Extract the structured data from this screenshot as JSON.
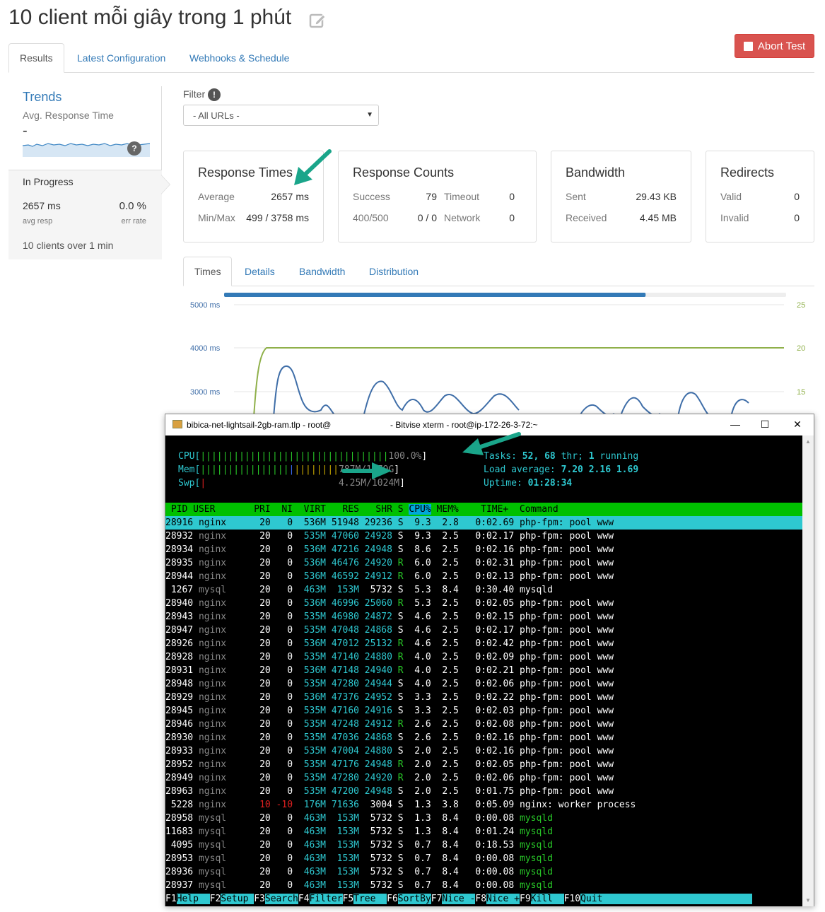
{
  "page": {
    "title": "10 client mỗi giây trong 1 phút",
    "abort_label": "Abort Test"
  },
  "tabs": [
    "Results",
    "Latest Configuration",
    "Webhooks & Schedule"
  ],
  "sidebar": {
    "trends_title": "Trends",
    "trends_sub": "Avg. Response Time",
    "trends_value": "-",
    "help_badge": "?",
    "status": "In Progress",
    "avg_value": "2657 ms",
    "avg_label": "avg resp",
    "err_value": "0.0 %",
    "err_label": "err rate",
    "clients_text": "10 clients over 1 min"
  },
  "filter": {
    "label": "Filter",
    "info": "!",
    "selected": "- All URLs -"
  },
  "cards": {
    "response_times": {
      "title": "Response Times",
      "avg_label": "Average",
      "avg_value": "2657 ms",
      "minmax_label": "Min/Max",
      "minmax_value": "499 / 3758 ms"
    },
    "response_counts": {
      "title": "Response Counts",
      "success_label": "Success",
      "success_value": "79",
      "timeout_label": "Timeout",
      "timeout_value": "0",
      "e400_label": "400/500",
      "e400_value": "0 / 0",
      "network_label": "Network",
      "network_value": "0"
    },
    "bandwidth": {
      "title": "Bandwidth",
      "sent_label": "Sent",
      "sent_value": "29.43 KB",
      "recv_label": "Received",
      "recv_value": "4.45 MB"
    },
    "redirects": {
      "title": "Redirects",
      "valid_label": "Valid",
      "valid_value": "0",
      "invalid_label": "Invalid",
      "invalid_value": "0"
    }
  },
  "subtabs": [
    "Times",
    "Details",
    "Bandwidth",
    "Distribution"
  ],
  "chart_data": {
    "type": "line",
    "left_axis_ticks": [
      "5000 ms",
      "4000 ms",
      "3000 ms"
    ],
    "right_axis_ticks": [
      "25",
      "20",
      "15"
    ],
    "progress": 0.75,
    "series": [
      {
        "values": [
          0,
          20,
          20,
          20,
          20,
          20,
          20,
          20,
          20,
          20,
          20,
          20
        ]
      },
      {
        "values": [
          1600,
          3600,
          3550,
          2700,
          2300,
          2900,
          2400,
          3200,
          2600,
          2200,
          2900,
          2400,
          2600,
          2300,
          2700,
          2900,
          2500,
          2300,
          2800,
          2500
        ]
      }
    ],
    "colors": {
      "clients": "#8fb04a",
      "response": "#3f6ea8",
      "progress": "#337ab7"
    }
  },
  "terminal": {
    "title_left": "bibica-net-lightsail-2gb-ram.tlp - root@",
    "title_right": "- Bitvise xterm - root@ip-172-26-3-72:~",
    "min": "—",
    "max": "☐",
    "close": "✕",
    "cpu_label": "CPU[",
    "cpu_bar": "||||||||||||||||||||||||||||||||||",
    "cpu_value": "100.0%",
    "mem_label": "Mem[",
    "mem_bar_green": "||||||||||||||||",
    "mem_bar_blue": "|",
    "mem_bar_yellow": "||||||||",
    "mem_value": "787M/1.79G",
    "swp_label": "Swp[",
    "swp_bar": "|",
    "swp_value": "4.25M/1024M",
    "tasks_label": "Tasks:",
    "tasks_value": "52,",
    "thr_value": "68",
    "thr_label": "thr;",
    "running_value": "1",
    "running_label": "running",
    "load_label": "Load average:",
    "load_values": "7.20 2.16 1.69",
    "uptime_label": "Uptime:",
    "uptime_value": "01:28:34",
    "header": " PID USER       PRI  NI  VIRT   RES   SHR S ",
    "header_cpu": "CPU%",
    "header_rest": " MEM%    TIME+  Command",
    "rows": [
      {
        "pid": "28916",
        "user": "nginx",
        "pri": "20",
        "ni": "0",
        "virt": "536M",
        "res": "51948",
        "shr": "29236",
        "s": "S",
        "cpu": "9.3",
        "mem": "2.8",
        "time": "0:02.69",
        "cmd": "php-fpm: pool www"
      },
      {
        "pid": "28932",
        "user": "nginx",
        "pri": "20",
        "ni": "0",
        "virt": "535M",
        "res": "47060",
        "shr": "24928",
        "s": "S",
        "cpu": "9.3",
        "mem": "2.5",
        "time": "0:02.17",
        "cmd": "php-fpm: pool www"
      },
      {
        "pid": "28934",
        "user": "nginx",
        "pri": "20",
        "ni": "0",
        "virt": "536M",
        "res": "47216",
        "shr": "24948",
        "s": "S",
        "cpu": "8.6",
        "mem": "2.5",
        "time": "0:02.16",
        "cmd": "php-fpm: pool www"
      },
      {
        "pid": "28935",
        "user": "nginx",
        "pri": "20",
        "ni": "0",
        "virt": "536M",
        "res": "46476",
        "shr": "24920",
        "s": "R",
        "cpu": "6.0",
        "mem": "2.5",
        "time": "0:02.31",
        "cmd": "php-fpm: pool www"
      },
      {
        "pid": "28944",
        "user": "nginx",
        "pri": "20",
        "ni": "0",
        "virt": "536M",
        "res": "46592",
        "shr": "24912",
        "s": "R",
        "cpu": "6.0",
        "mem": "2.5",
        "time": "0:02.13",
        "cmd": "php-fpm: pool www"
      },
      {
        "pid": "1267",
        "user": "mysql",
        "pri": "20",
        "ni": "0",
        "virt": "463M",
        "res": "153M",
        "shr": "5732",
        "s": "S",
        "cpu": "5.3",
        "mem": "8.4",
        "time": "0:30.40",
        "cmd": "mysqld"
      },
      {
        "pid": "28940",
        "user": "nginx",
        "pri": "20",
        "ni": "0",
        "virt": "536M",
        "res": "46996",
        "shr": "25060",
        "s": "R",
        "cpu": "5.3",
        "mem": "2.5",
        "time": "0:02.05",
        "cmd": "php-fpm: pool www"
      },
      {
        "pid": "28943",
        "user": "nginx",
        "pri": "20",
        "ni": "0",
        "virt": "535M",
        "res": "46980",
        "shr": "24872",
        "s": "S",
        "cpu": "4.6",
        "mem": "2.5",
        "time": "0:02.15",
        "cmd": "php-fpm: pool www"
      },
      {
        "pid": "28947",
        "user": "nginx",
        "pri": "20",
        "ni": "0",
        "virt": "535M",
        "res": "47048",
        "shr": "24868",
        "s": "S",
        "cpu": "4.6",
        "mem": "2.5",
        "time": "0:02.17",
        "cmd": "php-fpm: pool www"
      },
      {
        "pid": "28926",
        "user": "nginx",
        "pri": "20",
        "ni": "0",
        "virt": "536M",
        "res": "47012",
        "shr": "25132",
        "s": "R",
        "cpu": "4.6",
        "mem": "2.5",
        "time": "0:02.42",
        "cmd": "php-fpm: pool www"
      },
      {
        "pid": "28928",
        "user": "nginx",
        "pri": "20",
        "ni": "0",
        "virt": "535M",
        "res": "47140",
        "shr": "24880",
        "s": "R",
        "cpu": "4.0",
        "mem": "2.5",
        "time": "0:02.09",
        "cmd": "php-fpm: pool www"
      },
      {
        "pid": "28931",
        "user": "nginx",
        "pri": "20",
        "ni": "0",
        "virt": "536M",
        "res": "47148",
        "shr": "24940",
        "s": "R",
        "cpu": "4.0",
        "mem": "2.5",
        "time": "0:02.21",
        "cmd": "php-fpm: pool www"
      },
      {
        "pid": "28948",
        "user": "nginx",
        "pri": "20",
        "ni": "0",
        "virt": "535M",
        "res": "47280",
        "shr": "24944",
        "s": "S",
        "cpu": "4.0",
        "mem": "2.5",
        "time": "0:02.06",
        "cmd": "php-fpm: pool www"
      },
      {
        "pid": "28929",
        "user": "nginx",
        "pri": "20",
        "ni": "0",
        "virt": "536M",
        "res": "47376",
        "shr": "24952",
        "s": "S",
        "cpu": "3.3",
        "mem": "2.5",
        "time": "0:02.22",
        "cmd": "php-fpm: pool www"
      },
      {
        "pid": "28945",
        "user": "nginx",
        "pri": "20",
        "ni": "0",
        "virt": "535M",
        "res": "47160",
        "shr": "24916",
        "s": "S",
        "cpu": "3.3",
        "mem": "2.5",
        "time": "0:02.03",
        "cmd": "php-fpm: pool www"
      },
      {
        "pid": "28946",
        "user": "nginx",
        "pri": "20",
        "ni": "0",
        "virt": "535M",
        "res": "47248",
        "shr": "24912",
        "s": "R",
        "cpu": "2.6",
        "mem": "2.5",
        "time": "0:02.08",
        "cmd": "php-fpm: pool www"
      },
      {
        "pid": "28930",
        "user": "nginx",
        "pri": "20",
        "ni": "0",
        "virt": "535M",
        "res": "47036",
        "shr": "24868",
        "s": "S",
        "cpu": "2.6",
        "mem": "2.5",
        "time": "0:02.16",
        "cmd": "php-fpm: pool www"
      },
      {
        "pid": "28933",
        "user": "nginx",
        "pri": "20",
        "ni": "0",
        "virt": "535M",
        "res": "47004",
        "shr": "24880",
        "s": "S",
        "cpu": "2.0",
        "mem": "2.5",
        "time": "0:02.16",
        "cmd": "php-fpm: pool www"
      },
      {
        "pid": "28952",
        "user": "nginx",
        "pri": "20",
        "ni": "0",
        "virt": "535M",
        "res": "47176",
        "shr": "24948",
        "s": "R",
        "cpu": "2.0",
        "mem": "2.5",
        "time": "0:02.05",
        "cmd": "php-fpm: pool www"
      },
      {
        "pid": "28949",
        "user": "nginx",
        "pri": "20",
        "ni": "0",
        "virt": "535M",
        "res": "47280",
        "shr": "24920",
        "s": "R",
        "cpu": "2.0",
        "mem": "2.5",
        "time": "0:02.06",
        "cmd": "php-fpm: pool www"
      },
      {
        "pid": "28963",
        "user": "nginx",
        "pri": "20",
        "ni": "0",
        "virt": "535M",
        "res": "47200",
        "shr": "24948",
        "s": "S",
        "cpu": "2.0",
        "mem": "2.5",
        "time": "0:01.75",
        "cmd": "php-fpm: pool www"
      },
      {
        "pid": "5228",
        "user": "nginx",
        "pri": "10",
        "ni": "-10",
        "virt": "176M",
        "res": "71636",
        "shr": "3004",
        "s": "S",
        "cpu": "1.3",
        "mem": "3.8",
        "time": "0:05.09",
        "cmd": "nginx: worker process"
      },
      {
        "pid": "28958",
        "user": "mysql",
        "pri": "20",
        "ni": "0",
        "virt": "463M",
        "res": "153M",
        "shr": "5732",
        "s": "S",
        "cpu": "1.3",
        "mem": "8.4",
        "time": "0:00.08",
        "cmd": "mysqld"
      },
      {
        "pid": "11683",
        "user": "mysql",
        "pri": "20",
        "ni": "0",
        "virt": "463M",
        "res": "153M",
        "shr": "5732",
        "s": "S",
        "cpu": "1.3",
        "mem": "8.4",
        "time": "0:01.24",
        "cmd": "mysqld"
      },
      {
        "pid": "4095",
        "user": "mysql",
        "pri": "20",
        "ni": "0",
        "virt": "463M",
        "res": "153M",
        "shr": "5732",
        "s": "S",
        "cpu": "0.7",
        "mem": "8.4",
        "time": "0:18.53",
        "cmd": "mysqld"
      },
      {
        "pid": "28953",
        "user": "mysql",
        "pri": "20",
        "ni": "0",
        "virt": "463M",
        "res": "153M",
        "shr": "5732",
        "s": "S",
        "cpu": "0.7",
        "mem": "8.4",
        "time": "0:00.08",
        "cmd": "mysqld"
      },
      {
        "pid": "28936",
        "user": "mysql",
        "pri": "20",
        "ni": "0",
        "virt": "463M",
        "res": "153M",
        "shr": "5732",
        "s": "S",
        "cpu": "0.7",
        "mem": "8.4",
        "time": "0:00.08",
        "cmd": "mysqld"
      },
      {
        "pid": "28937",
        "user": "mysql",
        "pri": "20",
        "ni": "0",
        "virt": "463M",
        "res": "153M",
        "shr": "5732",
        "s": "S",
        "cpu": "0.7",
        "mem": "8.4",
        "time": "0:00.08",
        "cmd": "mysqld"
      }
    ],
    "fkeys": [
      {
        "key": "F1",
        "label": "Help  "
      },
      {
        "key": "F2",
        "label": "Setup "
      },
      {
        "key": "F3",
        "label": "Search"
      },
      {
        "key": "F4",
        "label": "Filter"
      },
      {
        "key": "F5",
        "label": "Tree  "
      },
      {
        "key": "F6",
        "label": "SortBy"
      },
      {
        "key": "F7",
        "label": "Nice -"
      },
      {
        "key": "F8",
        "label": "Nice +"
      },
      {
        "key": "F9",
        "label": "Kill  "
      },
      {
        "key": "F10",
        "label": "Quit                           "
      }
    ]
  }
}
